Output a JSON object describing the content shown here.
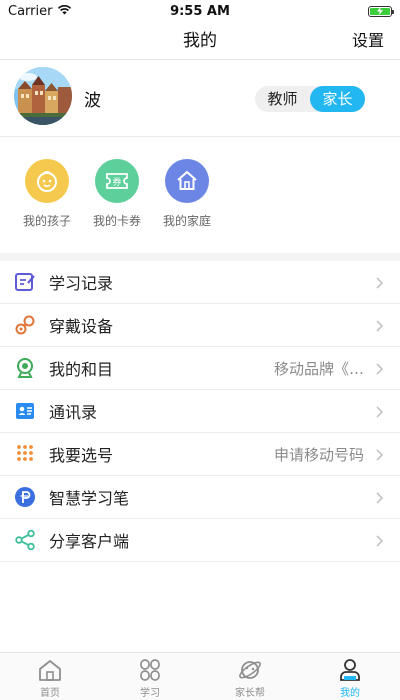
{
  "status_bar": {
    "carrier": "Carrier",
    "time": "9:55 AM",
    "icons": [
      "wifi-icon",
      "battery-charging-icon"
    ]
  },
  "header": {
    "title": "我的",
    "settings_label": "设置"
  },
  "profile": {
    "name": "波",
    "avatar": "avatar-photo",
    "roles": [
      {
        "label": "教师",
        "active": false
      },
      {
        "label": "家长",
        "active": true
      }
    ]
  },
  "quick_actions": [
    {
      "label": "我的孩子",
      "icon": "child-face-icon",
      "color": "#f5c94d"
    },
    {
      "label": "我的卡券",
      "icon": "coupon-icon",
      "color": "#5ccf9a"
    },
    {
      "label": "我的家庭",
      "icon": "home-icon",
      "color": "#6b86e5"
    }
  ],
  "menu": [
    {
      "label": "学习记录",
      "value": "",
      "icon": "edit-note-icon"
    },
    {
      "label": "穿戴设备",
      "value": "",
      "icon": "wearable-device-icon"
    },
    {
      "label": "我的和目",
      "value": "移动品牌《…",
      "icon": "webcam-icon"
    },
    {
      "label": "通讯录",
      "value": "",
      "icon": "contacts-icon"
    },
    {
      "label": "我要选号",
      "value": "申请移动号码",
      "icon": "dial-pad-icon"
    },
    {
      "label": "智慧学习笔",
      "value": "",
      "icon": "smart-pen-icon"
    },
    {
      "label": "分享客户端",
      "value": "",
      "icon": "share-icon"
    }
  ],
  "tab_bar": [
    {
      "label": "首页",
      "icon": "home-outline-icon",
      "active": false
    },
    {
      "label": "学习",
      "icon": "clover-icon",
      "active": false
    },
    {
      "label": "家长帮",
      "icon": "planet-icon",
      "active": false
    },
    {
      "label": "我的",
      "icon": "profile-icon",
      "active": true
    }
  ],
  "colors": {
    "accent": "#22b7f0",
    "battery": "#3ccd3c"
  }
}
